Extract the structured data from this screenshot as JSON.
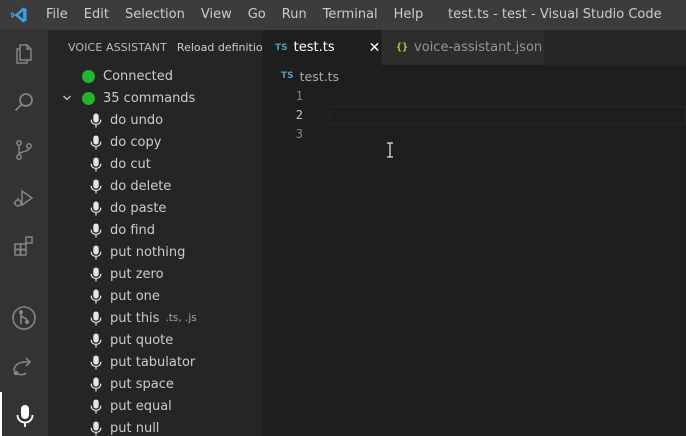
{
  "titlebar": {
    "menu": [
      "File",
      "Edit",
      "Selection",
      "View",
      "Go",
      "Run",
      "Terminal",
      "Help"
    ],
    "window_title": "test.ts - test - Visual Studio Code"
  },
  "activitybar": {
    "icons": [
      "explorer-icon",
      "search-icon",
      "source-control-icon",
      "run-debug-icon",
      "extensions-icon",
      "git-graph-icon",
      "remote-share-icon",
      "microphone-icon"
    ]
  },
  "sidebar": {
    "title": "VOICE ASSISTANT",
    "action": "Reload definition",
    "status": "Connected",
    "group": "35 commands",
    "commands": [
      {
        "label": "do undo",
        "desc": ""
      },
      {
        "label": "do copy",
        "desc": ""
      },
      {
        "label": "do cut",
        "desc": ""
      },
      {
        "label": "do delete",
        "desc": ""
      },
      {
        "label": "do paste",
        "desc": ""
      },
      {
        "label": "do find",
        "desc": ""
      },
      {
        "label": "put nothing",
        "desc": ""
      },
      {
        "label": "put zero",
        "desc": ""
      },
      {
        "label": "put one",
        "desc": ""
      },
      {
        "label": "put this",
        "desc": ".ts, .js"
      },
      {
        "label": "put quote",
        "desc": ""
      },
      {
        "label": "put tabulator",
        "desc": ""
      },
      {
        "label": "put space",
        "desc": ""
      },
      {
        "label": "put equal",
        "desc": ""
      },
      {
        "label": "put null",
        "desc": ""
      }
    ]
  },
  "tabs": [
    {
      "badge": "TS",
      "label": "test.ts",
      "active": true,
      "close": "✕"
    },
    {
      "badge": "{}",
      "label": "voice-assistant.json",
      "active": false
    }
  ],
  "breadcrumb": {
    "badge": "TS",
    "file": "test.ts"
  },
  "editor": {
    "lines": [
      "1",
      "2",
      "3"
    ],
    "current_line": 2
  },
  "colors": {
    "status_dot": "#22b52d",
    "ts_badge": "#519aba",
    "json_badge": "#cbcb41"
  }
}
